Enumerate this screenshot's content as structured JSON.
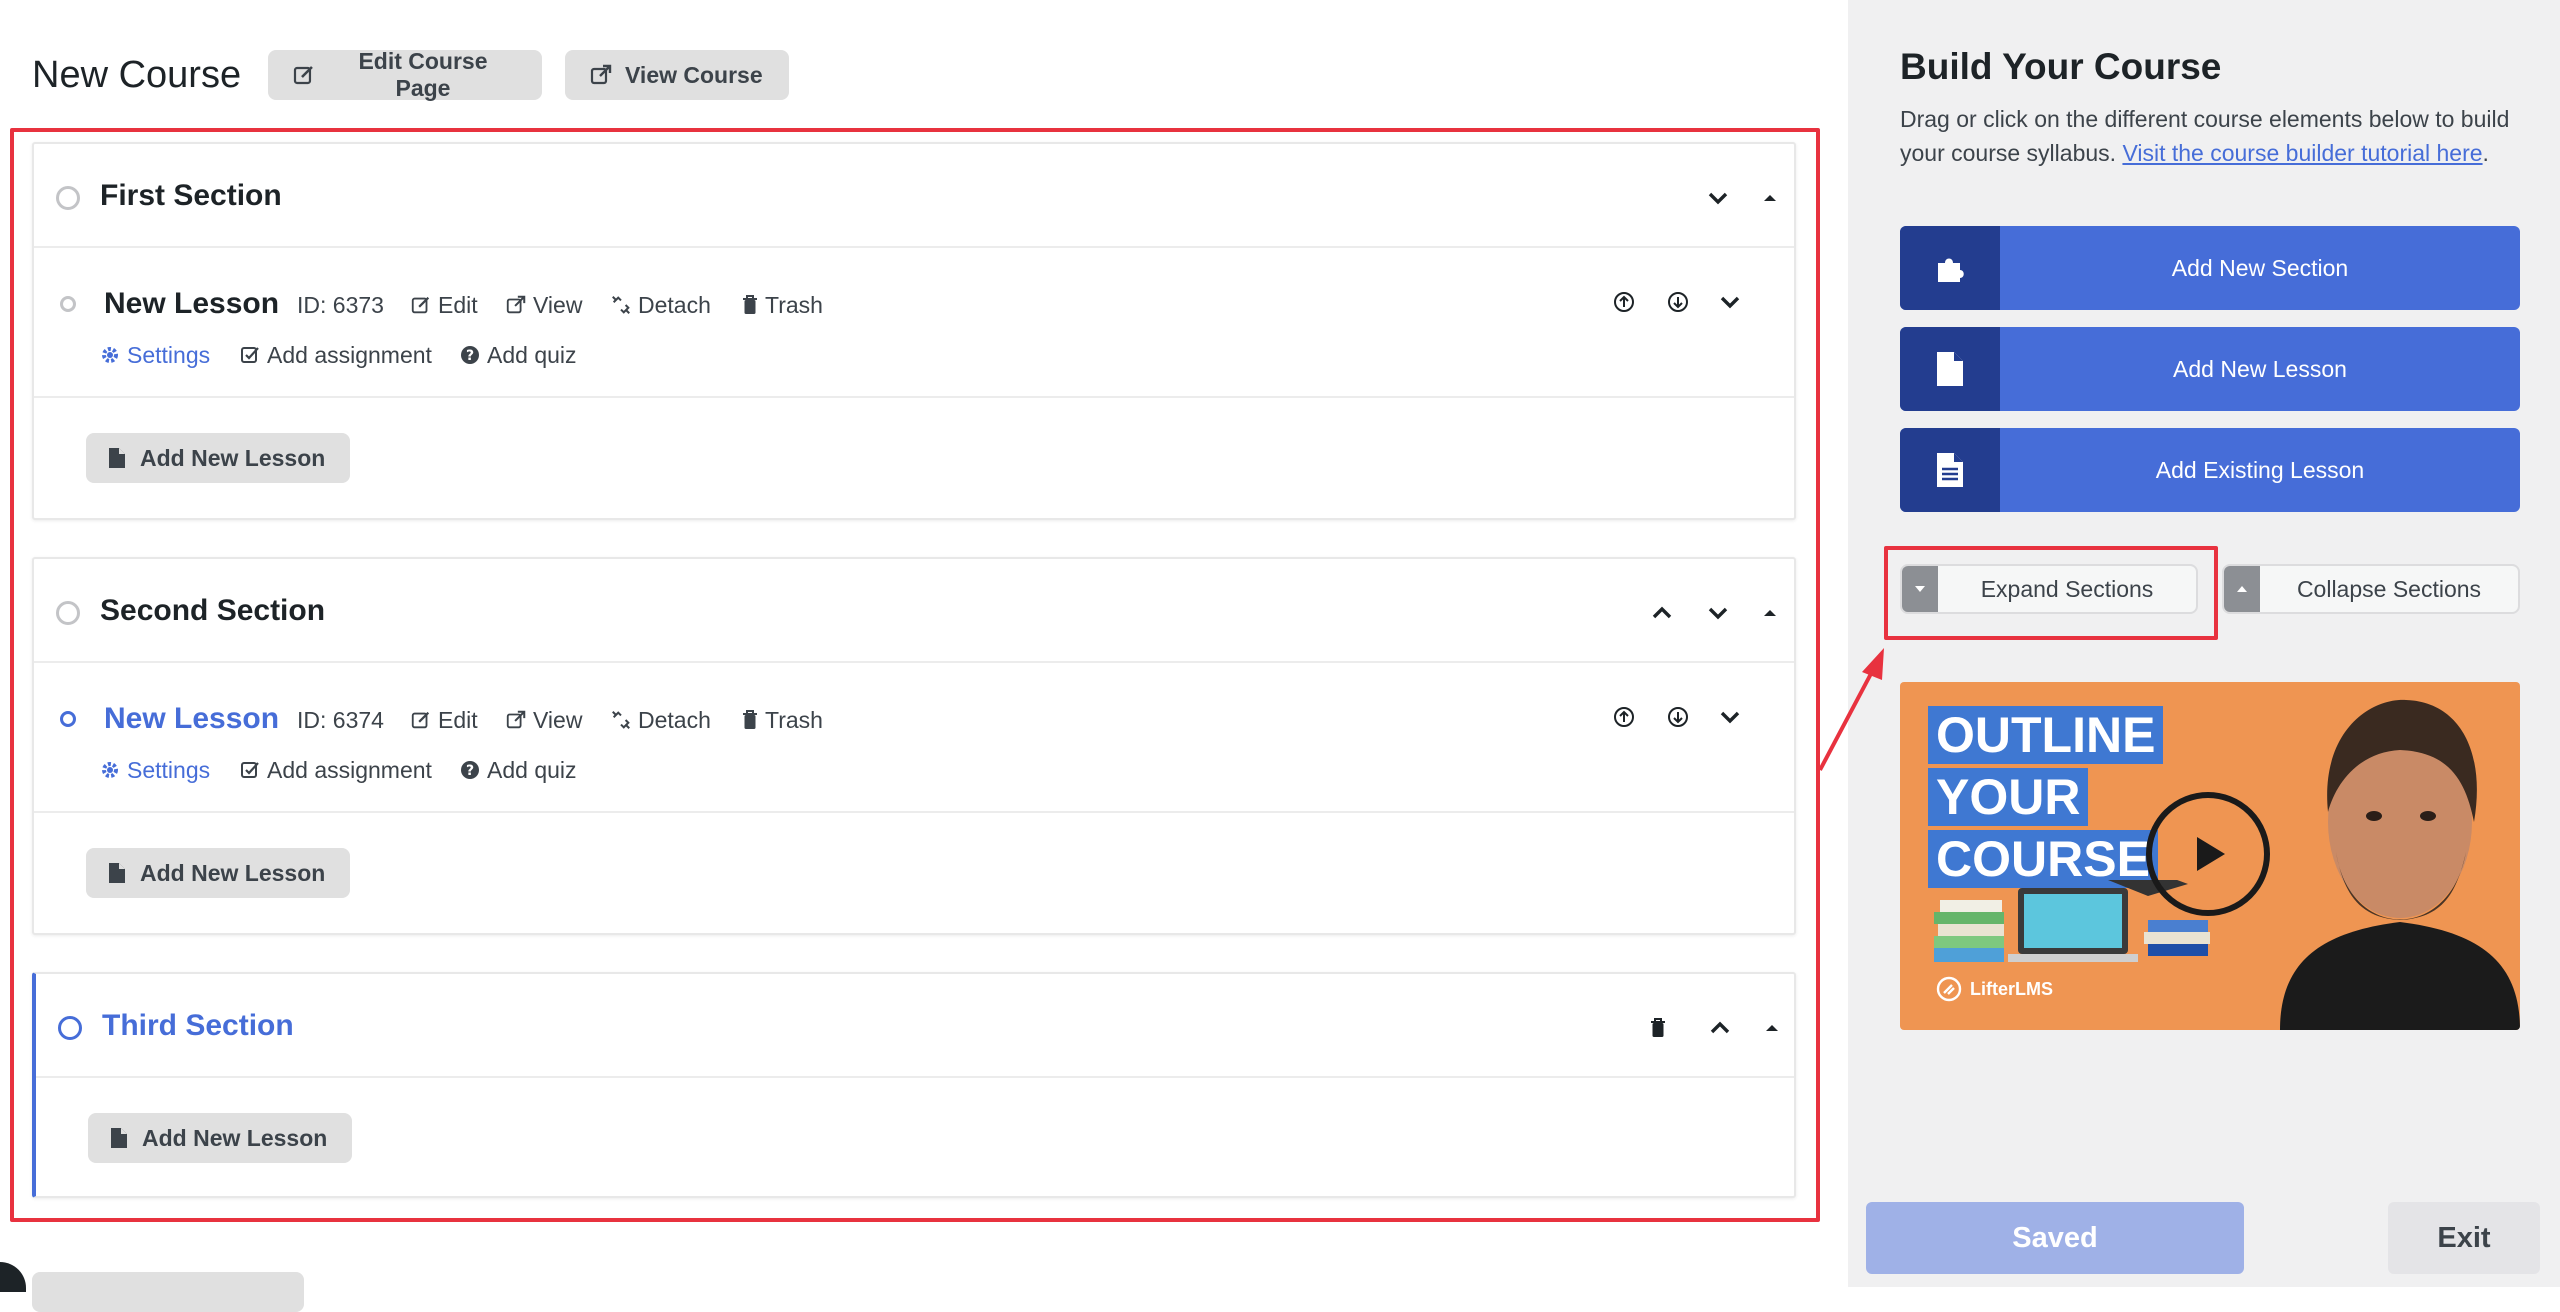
{
  "header": {
    "title": "New Course",
    "edit_course_page": "Edit Course Page",
    "view_course": "View Course"
  },
  "sections": [
    {
      "title": "First Section",
      "lesson": {
        "title": "New Lesson",
        "id": "ID: 6373",
        "edit": "Edit",
        "view": "View",
        "detach": "Detach",
        "trash": "Trash",
        "settings": "Settings",
        "add_assignment": "Add assignment",
        "add_quiz": "Add quiz"
      },
      "add_lesson": "Add New Lesson"
    },
    {
      "title": "Second Section",
      "lesson": {
        "title": "New Lesson",
        "id": "ID: 6374",
        "edit": "Edit",
        "view": "View",
        "detach": "Detach",
        "trash": "Trash",
        "settings": "Settings",
        "add_assignment": "Add assignment",
        "add_quiz": "Add quiz"
      },
      "add_lesson": "Add New Lesson"
    },
    {
      "title": "Third Section",
      "add_lesson": "Add New Lesson"
    }
  ],
  "sidebar": {
    "title": "Build Your Course",
    "description": "Drag or click on the different course elements below to build your course syllabus.",
    "tutorial_link": "Visit the course builder tutorial here",
    "period": ".",
    "elements": [
      {
        "label": "Add New Section",
        "icon": "puzzle-icon"
      },
      {
        "label": "Add New Lesson",
        "icon": "file-icon"
      },
      {
        "label": "Add Existing Lesson",
        "icon": "file-text-icon"
      }
    ],
    "expand_sections": "Expand Sections",
    "collapse_sections": "Collapse Sections",
    "video": {
      "line1": "OUTLINE",
      "line2": "YOUR",
      "line3": "COURSE",
      "brand": "LifterLMS"
    },
    "saved": "Saved",
    "exit": "Exit"
  },
  "colors": {
    "accent": "#466dd8",
    "accent_dark": "#233d8f",
    "highlight": "#e8323f",
    "saved_disabled": "#9fb1e7",
    "video_bg": "#ef9552"
  }
}
